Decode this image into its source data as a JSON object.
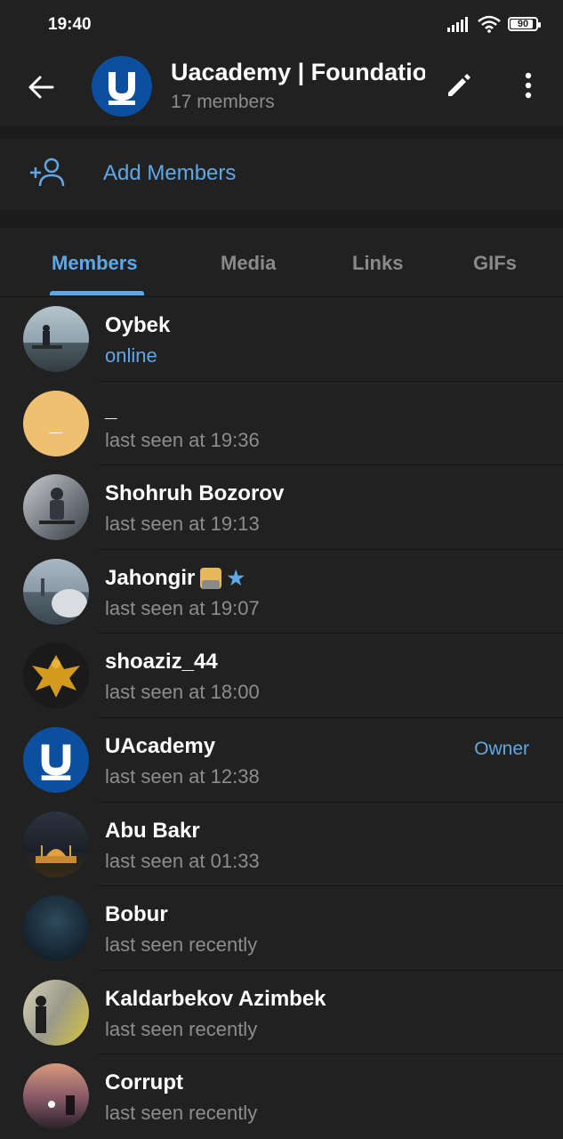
{
  "status_bar": {
    "time": "19:40",
    "battery": "90",
    "battery_level": 0.9
  },
  "header": {
    "title": "Uacademy | Foundation",
    "subtitle": "17 members"
  },
  "add_members": {
    "label": "Add Members"
  },
  "tabs": [
    {
      "label": "Members",
      "active": true
    },
    {
      "label": "Media",
      "active": false
    },
    {
      "label": "Links",
      "active": false
    },
    {
      "label": "GIFs",
      "active": false
    }
  ],
  "members": [
    {
      "name": "Oybek",
      "status": "online",
      "role": ""
    },
    {
      "name": "_",
      "status": "last seen at 19:36",
      "role": ""
    },
    {
      "name": "Shohruh Bozorov",
      "status": "last seen at 19:13",
      "role": ""
    },
    {
      "name": "Jahongir",
      "status": "last seen at 19:07",
      "role": ""
    },
    {
      "name": "shoaziz_44",
      "status": "last seen at 18:00",
      "role": ""
    },
    {
      "name": "UAcademy",
      "status": "last seen at 12:38",
      "role": "Owner"
    },
    {
      "name": "Abu Bakr",
      "status": "last seen at 01:33",
      "role": ""
    },
    {
      "name": "Bobur",
      "status": "last seen recently",
      "role": ""
    },
    {
      "name": "Kaldarbekov Azimbek",
      "status": "last seen recently",
      "role": ""
    },
    {
      "name": "Corrupt",
      "status": "last seen recently",
      "role": ""
    }
  ],
  "colors": {
    "accent": "#5fa8e8",
    "background": "#212121",
    "brand": "#0c4f9e"
  }
}
